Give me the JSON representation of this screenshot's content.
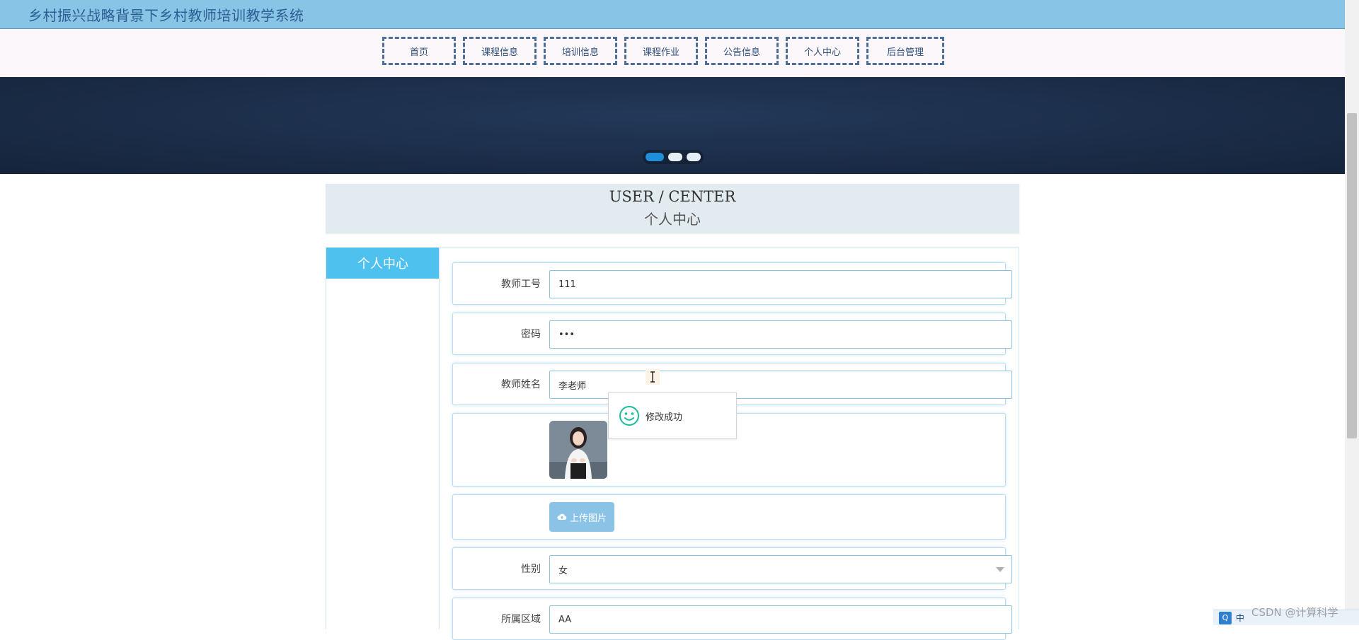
{
  "header": {
    "site_title": "乡村振兴战略背景下乡村教师培训教学系统"
  },
  "nav": {
    "items": [
      {
        "label": "首页"
      },
      {
        "label": "课程信息"
      },
      {
        "label": "培训信息"
      },
      {
        "label": "课程作业"
      },
      {
        "label": "公告信息"
      },
      {
        "label": "个人中心"
      },
      {
        "label": "后台管理"
      }
    ]
  },
  "banner": {
    "active_slide": 1,
    "slide_count": 3
  },
  "user_center": {
    "title_en": "USER / CENTER",
    "title_cn": "个人中心"
  },
  "sidebar": {
    "items": [
      {
        "label": "个人中心"
      }
    ]
  },
  "form": {
    "teacher_id": {
      "label": "教师工号",
      "value": "111"
    },
    "password": {
      "label": "密码",
      "value": "•••"
    },
    "teacher_name": {
      "label": "教师姓名",
      "value": "李老师"
    },
    "upload": {
      "label": "上传图片"
    },
    "gender": {
      "label": "性别",
      "value": "女"
    },
    "region": {
      "label": "所属区域",
      "value": "AA"
    }
  },
  "toast": {
    "message": "修改成功"
  },
  "tray": {
    "q_label": "Q",
    "ime_label": "中"
  },
  "watermark": "CSDN @计算科学",
  "colors": {
    "header_bg": "#87c4e6",
    "nav_border": "#4d6d9a",
    "sidebar_active": "#4fc1ee",
    "banner_bg": "#1b2d48",
    "upload_btn": "#8bc3e6",
    "toast_smile": "#1abc9c"
  },
  "icons": {
    "upload": "cloud-upload-icon",
    "toast": "smile-icon",
    "select": "chevron-down-icon"
  }
}
